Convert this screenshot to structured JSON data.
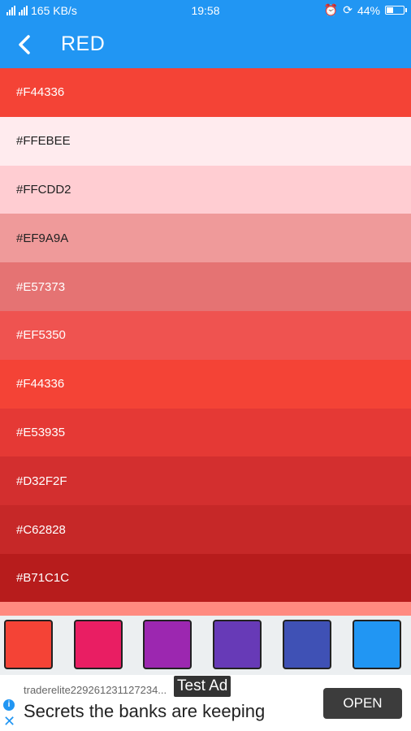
{
  "status_bar": {
    "network_speed": "165 KB/s",
    "time": "19:58",
    "battery": "44%",
    "battery_level": 0.44
  },
  "app_bar": {
    "title": "RED",
    "back_icon": "chevron-left-icon"
  },
  "colors": [
    {
      "hex": "#F44336",
      "text_color": "#FFFFFF"
    },
    {
      "hex": "#FFEBEE",
      "text_color": "#222222"
    },
    {
      "hex": "#FFCDD2",
      "text_color": "#222222"
    },
    {
      "hex": "#EF9A9A",
      "text_color": "#222222"
    },
    {
      "hex": "#E57373",
      "text_color": "#FFFFFF"
    },
    {
      "hex": "#EF5350",
      "text_color": "#FFFFFF"
    },
    {
      "hex": "#F44336",
      "text_color": "#FFFFFF"
    },
    {
      "hex": "#E53935",
      "text_color": "#FFFFFF"
    },
    {
      "hex": "#D32F2F",
      "text_color": "#FFFFFF"
    },
    {
      "hex": "#C62828",
      "text_color": "#FFFFFF"
    },
    {
      "hex": "#B71C1C",
      "text_color": "#FFFFFF"
    }
  ],
  "palette": [
    "#F44336",
    "#E91E63",
    "#9C27B0",
    "#673AB7",
    "#3F51B5",
    "#2196F3"
  ],
  "ad": {
    "advertiser": "traderelite229261231127234...",
    "headline": "Secrets the banks are keeping",
    "cta": "OPEN",
    "badge": "Test Ad"
  }
}
